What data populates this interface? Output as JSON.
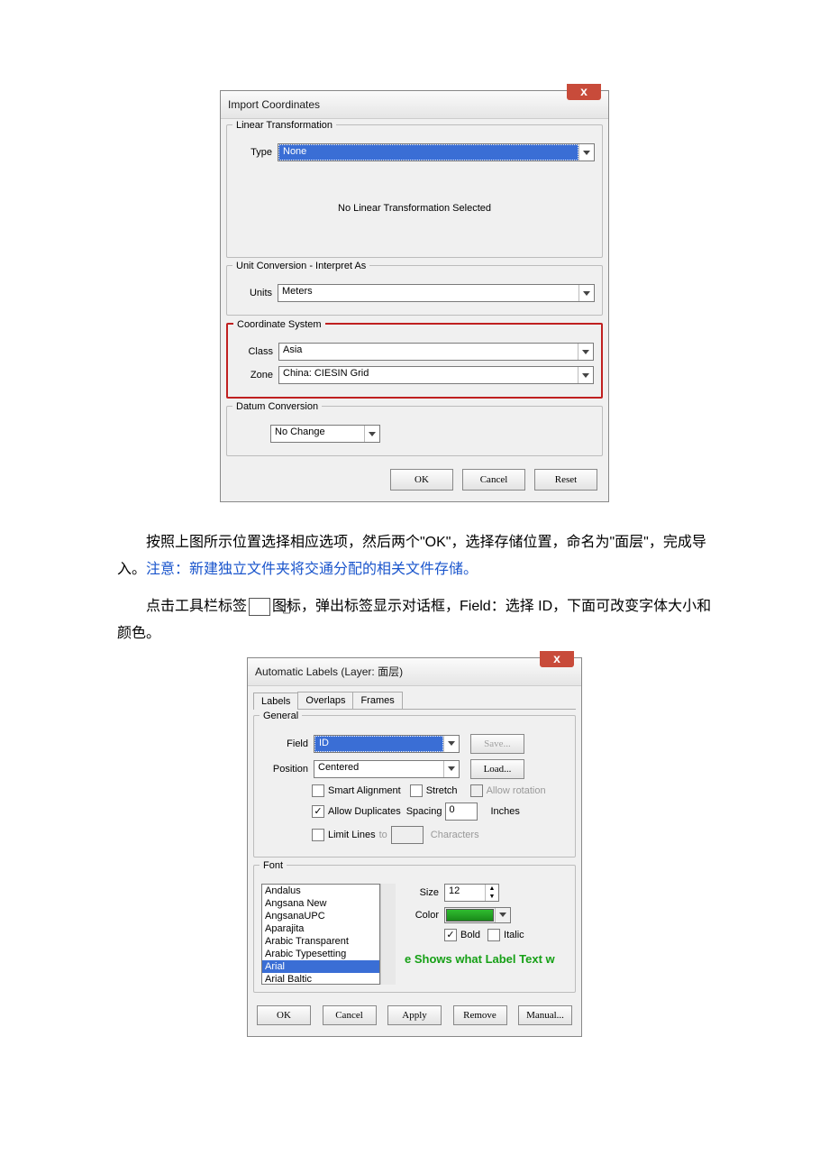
{
  "dialog1": {
    "title": "Import Coordinates",
    "linear": {
      "legend": "Linear Transformation",
      "type_label": "Type",
      "type_value": "None",
      "msg": "No Linear Transformation Selected"
    },
    "unit": {
      "legend": "Unit Conversion - Interpret As",
      "label": "Units",
      "value": "Meters"
    },
    "coord": {
      "legend": "Coordinate System",
      "class_label": "Class",
      "class_value": "Asia",
      "zone_label": "Zone",
      "zone_value": "China:             CIESIN Grid"
    },
    "datum": {
      "legend": "Datum Conversion",
      "value": "No Change"
    },
    "buttons": {
      "ok": "OK",
      "cancel": "Cancel",
      "reset": "Reset"
    }
  },
  "para1_a": "按照上图所示位置选择相应选项，然后两个\"OK\"，选择存储位置，命名为\"面层\"，完成导入。",
  "para1_b": "注意：新建独立文件夹将交通分配的相关文件存储。",
  "para2_a": "点击工具栏标签",
  "para2_b": "图标，弹出标签显示对话框，Field：选择 ID，下面可改变字体大小和颜色。",
  "dialog2": {
    "title": "Automatic Labels (Layer: 面层)",
    "tabs": {
      "labels": "Labels",
      "overlaps": "Overlaps",
      "frames": "Frames"
    },
    "general": {
      "legend": "General",
      "field_label": "Field",
      "field_value": "ID",
      "save": "Save...",
      "position_label": "Position",
      "position_value": "Centered",
      "load": "Load...",
      "smart": "Smart Alignment",
      "stretch": "Stretch",
      "allow_rotation": "Allow rotation",
      "allow_dup": "Allow Duplicates",
      "spacing_label": "Spacing",
      "spacing_value": "0",
      "spacing_unit": "Inches",
      "limit_lines": "Limit Lines",
      "limit_to": "to",
      "limit_chars": "Characters"
    },
    "font": {
      "legend": "Font",
      "list": [
        "Andalus",
        "Angsana New",
        "AngsanaUPC",
        "Aparajita",
        "Arabic Transparent",
        "Arabic Typesetting",
        "Arial",
        "Arial Baltic"
      ],
      "selected": "Arial",
      "size_label": "Size",
      "size_value": "12",
      "color_label": "Color",
      "bold": "Bold",
      "italic": "Italic",
      "preview": "e Shows what Label Text w"
    },
    "buttons": {
      "ok": "OK",
      "cancel": "Cancel",
      "apply": "Apply",
      "remove": "Remove",
      "manual": "Manual..."
    }
  }
}
